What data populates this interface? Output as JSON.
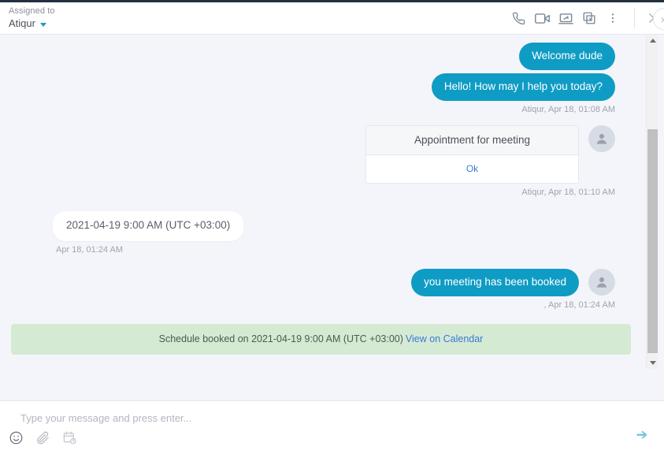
{
  "header": {
    "assigned_label": "Assigned to",
    "assigned_name": "Atiqur",
    "icons": {
      "call": "phone-icon",
      "video": "video-camera-icon",
      "screenshare": "screen-share-icon",
      "copy": "copy-icon",
      "more": "more-vertical-icon",
      "close": "close-icon",
      "expand": "chevron-double-right-icon"
    }
  },
  "chat": {
    "messages": [
      {
        "id": "m1",
        "direction": "out",
        "type": "text",
        "text": "Welcome dude"
      },
      {
        "id": "m2",
        "direction": "out",
        "type": "text",
        "text": "Hello! How may I help you today?",
        "stamp": "Atiqur, Apr 18, 01:08 AM"
      },
      {
        "id": "m3",
        "direction": "out",
        "type": "card",
        "card_title": "Appointment for meeting",
        "card_action": "Ok",
        "stamp": "Atiqur, Apr 18, 01:10 AM"
      },
      {
        "id": "m4",
        "direction": "in",
        "type": "text",
        "text": "2021-04-19 9:00 AM (UTC +03:00)",
        "stamp": "Apr 18, 01:24 AM"
      },
      {
        "id": "m5",
        "direction": "out",
        "type": "text",
        "text": "you meeting has been booked",
        "stamp": ", Apr 18, 01:24 AM"
      }
    ],
    "notice": {
      "text": "Schedule booked on 2021-04-19 9:00 AM (UTC +03:00)",
      "link": "View on Calendar"
    }
  },
  "composer": {
    "placeholder": "Type your message and press enter...",
    "value": "",
    "tools": {
      "emoji": "emoji-icon",
      "attachment": "paperclip-icon",
      "schedule": "calendar-clock-icon",
      "send": "send-icon"
    }
  },
  "colors": {
    "accent_teal": "#0f9cc4",
    "link_blue": "#3b78d8",
    "notice_green": "#d4ead3",
    "chat_bg": "#f4f5fa",
    "top_strip": "#22313f",
    "send_blue": "#6fc4dd"
  }
}
